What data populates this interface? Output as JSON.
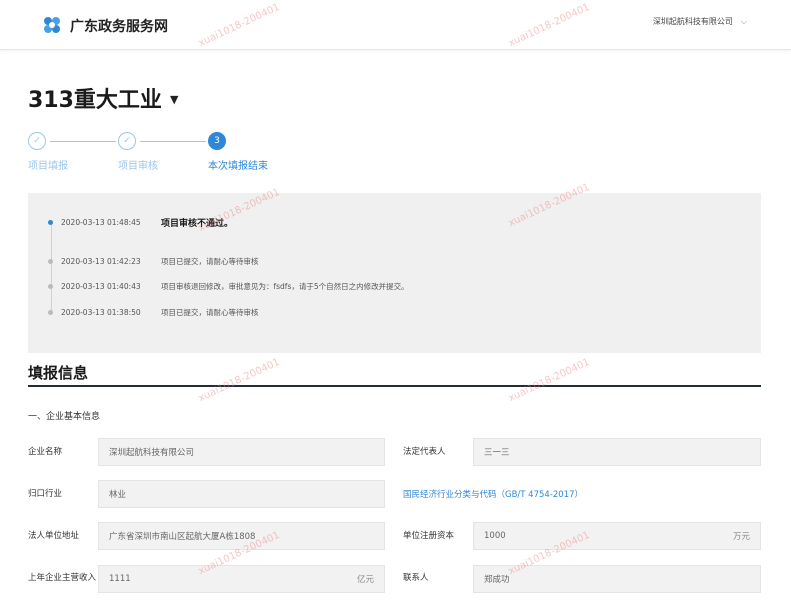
{
  "header": {
    "site_title": "广东政务服务网",
    "company": "深圳起航科技有限公司",
    "logo_icon": "gd-logo-icon",
    "accent": "#2f87d8"
  },
  "project": {
    "title": "313重大工业"
  },
  "steps": [
    {
      "num": "✓",
      "label": "项目填报",
      "state": "done"
    },
    {
      "num": "✓",
      "label": "项目审核",
      "state": "done"
    },
    {
      "num": "3",
      "label": "本次填报结束",
      "state": "active"
    }
  ],
  "timeline": [
    {
      "time": "2020-03-13 01:48:45",
      "msg": "项目审核不通过。"
    },
    {
      "time": "2020-03-13 01:42:23",
      "msg": "项目已提交，请耐心等待审核"
    },
    {
      "time": "2020-03-13 01:40:43",
      "msg": "项目审核退回修改，审批意见为：fsdfs，请于5个自然日之内修改并提交。"
    },
    {
      "time": "2020-03-13 01:38:50",
      "msg": "项目已提交，请耐心等待审核"
    }
  ],
  "section": {
    "title": "填报信息",
    "subtitle": "一、企业基本信息"
  },
  "form": {
    "company_name_label": "企业名称",
    "company_name": "深圳起航科技有限公司",
    "legal_rep_label": "法定代表人",
    "legal_rep": "三一三",
    "industry_label": "归口行业",
    "industry": "林业",
    "industry_link": "国民经济行业分类与代码（GB/T 4754-2017）",
    "address_label": "法人单位地址",
    "address": "广东省深圳市南山区起航大厦A栋1808",
    "capital_label": "单位注册资本",
    "capital": "1000",
    "capital_unit": "万元",
    "revenue_label": "上年企业主营收入",
    "revenue": "1111",
    "revenue_unit": "亿元",
    "contact_label": "联系人",
    "contact": "郑成功"
  },
  "watermark": "xuai1018-200401"
}
